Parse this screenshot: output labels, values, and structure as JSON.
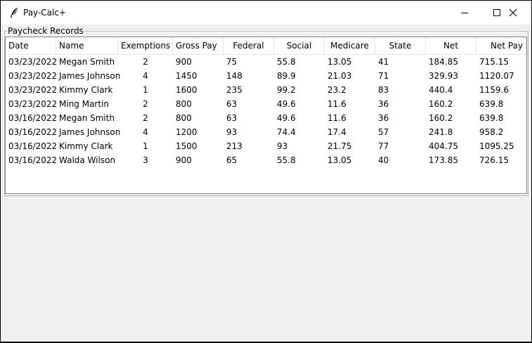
{
  "window": {
    "title": "Pay-Calc+",
    "icon": "feather-icon"
  },
  "group": {
    "label": "Paycheck Records"
  },
  "table": {
    "columns": [
      "Date",
      "Name",
      "Exemptions",
      "Gross Pay",
      "Federal",
      "Social",
      "Medicare",
      "State",
      "Net",
      "Net Pay"
    ],
    "rows": [
      [
        "03/23/2022",
        "Megan Smith",
        "2",
        "900",
        "75",
        "55.8",
        "13.05",
        "41",
        "184.85",
        "715.15"
      ],
      [
        "03/23/2022",
        "James Johnson",
        "4",
        "1450",
        "148",
        "89.9",
        "21.03",
        "71",
        "329.93",
        "1120.07"
      ],
      [
        "03/23/2022",
        "Kimmy Clark",
        "1",
        "1600",
        "235",
        "99.2",
        "23.2",
        "83",
        "440.4",
        "1159.6"
      ],
      [
        "03/23/2022",
        "Ming Martin",
        "2",
        "800",
        "63",
        "49.6",
        "11.6",
        "36",
        "160.2",
        "639.8"
      ],
      [
        "03/16/2022",
        "Megan Smith",
        "2",
        "800",
        "63",
        "49.6",
        "11.6",
        "36",
        "160.2",
        "639.8"
      ],
      [
        "03/16/2022",
        "James Johnson",
        "4",
        "1200",
        "93",
        "74.4",
        "17.4",
        "57",
        "241.8",
        "958.2"
      ],
      [
        "03/16/2022",
        "Kimmy Clark",
        "1",
        "1500",
        "213",
        "93",
        "21.75",
        "77",
        "404.75",
        "1095.25"
      ],
      [
        "03/16/2022",
        "Walda Wilson",
        "3",
        "900",
        "65",
        "55.8",
        "13.05",
        "40",
        "173.85",
        "726.15"
      ]
    ]
  }
}
